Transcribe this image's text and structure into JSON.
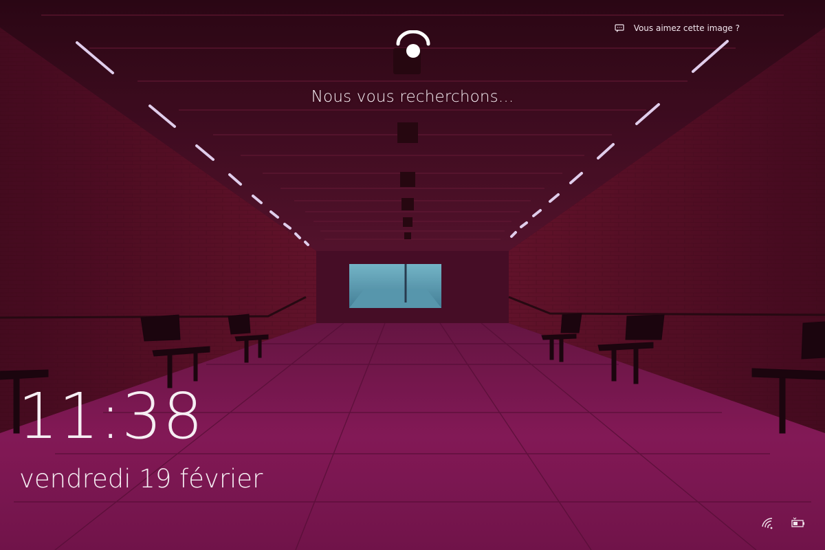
{
  "lockscreen": {
    "feedback": {
      "label": "Vous aimez cette image ?",
      "icon": "chat-bubble-icon"
    },
    "face_icon": "face-recognition-icon",
    "status": "Nous vous recherchons...",
    "time": "11:38",
    "date": "vendredi 19 février",
    "tray": {
      "network_icon": "wifi-icon",
      "battery_icon": "battery-icon"
    }
  },
  "colors": {
    "accent": "#ffffff",
    "wall": "#5c0f2a",
    "floor": "#8a1a58",
    "ceiling": "#3e0a22"
  }
}
